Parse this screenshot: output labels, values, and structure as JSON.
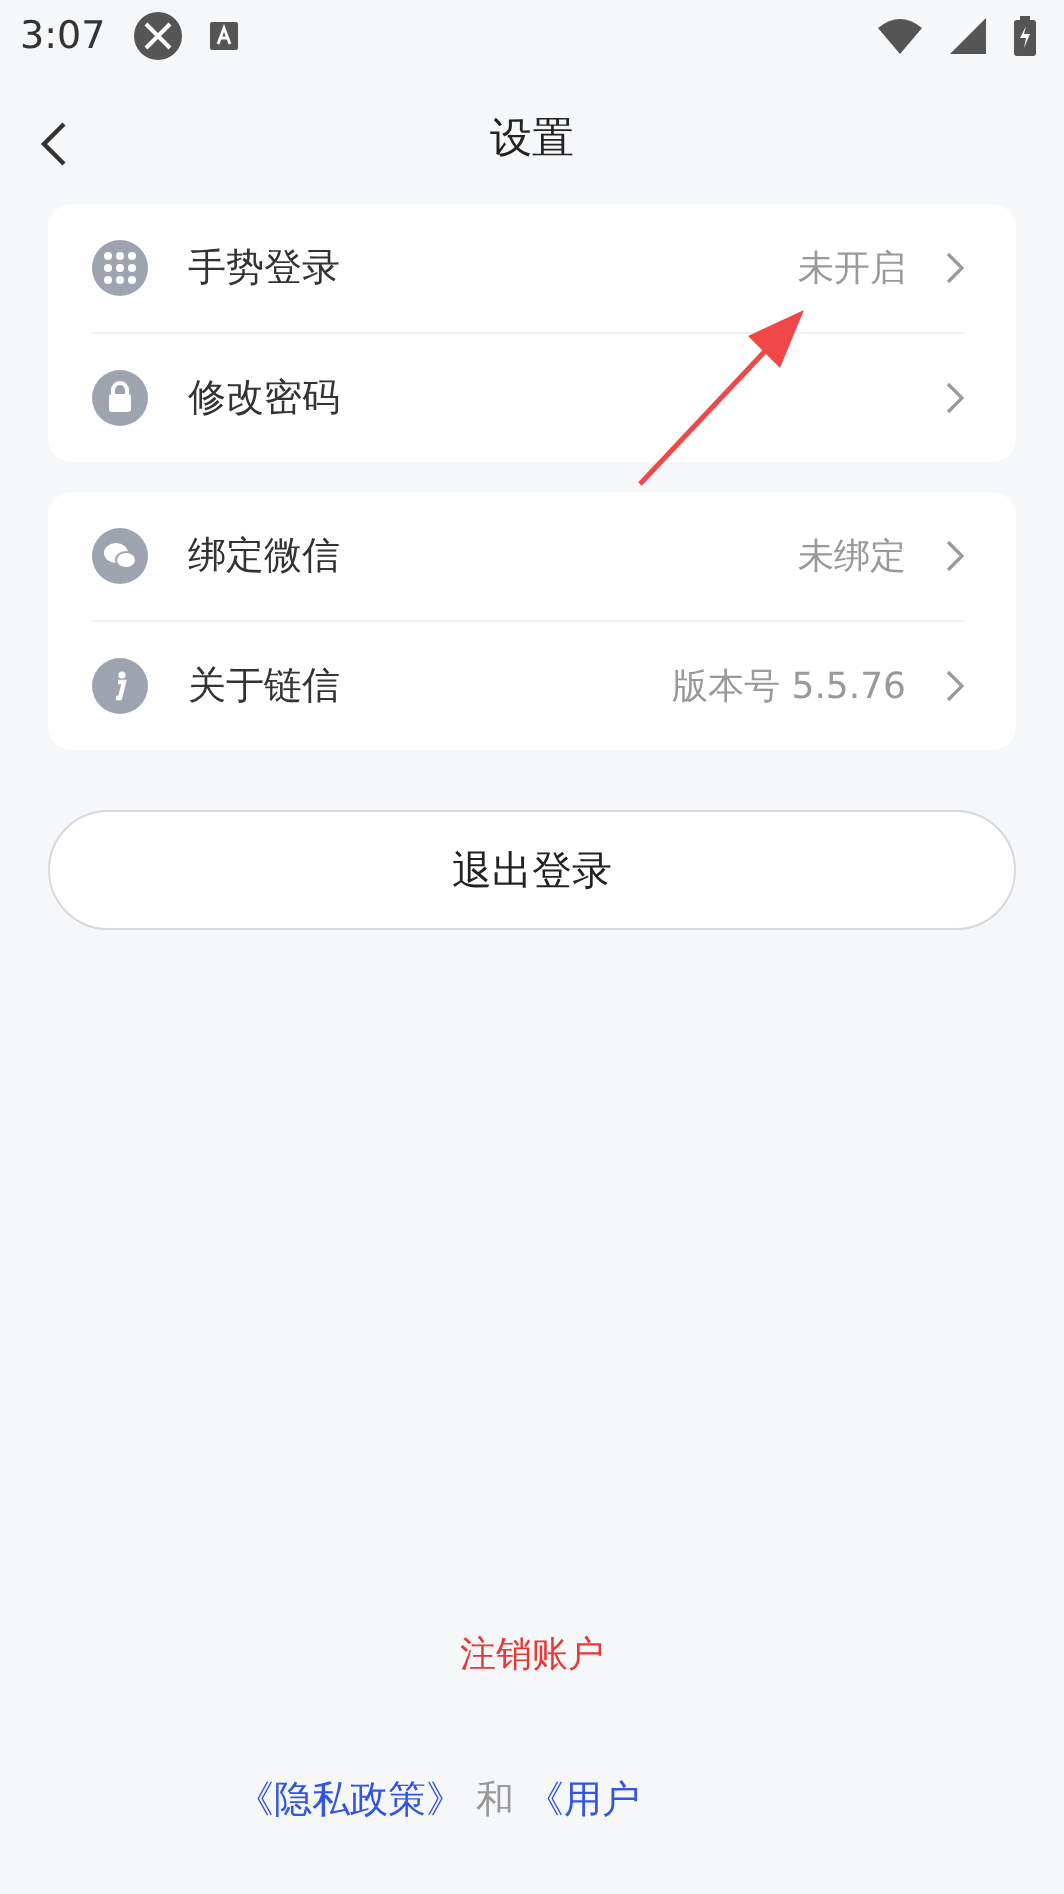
{
  "status_bar": {
    "time": "3:07"
  },
  "header": {
    "title": "设置"
  },
  "groups": [
    {
      "rows": [
        {
          "label": "手势登录",
          "value": "未开启"
        },
        {
          "label": "修改密码"
        }
      ]
    },
    {
      "rows": [
        {
          "label": "绑定微信",
          "value": "未绑定"
        },
        {
          "label": "关于链信",
          "value": "版本号 5.5.76"
        }
      ]
    }
  ],
  "logout_button": "退出登录",
  "delete_account_link": "注销账户",
  "footer": [
    {
      "kind": "link",
      "text": "《隐私政策》"
    },
    {
      "kind": "plain",
      "text": "和"
    },
    {
      "kind": "link",
      "text": "《用户"
    }
  ]
}
